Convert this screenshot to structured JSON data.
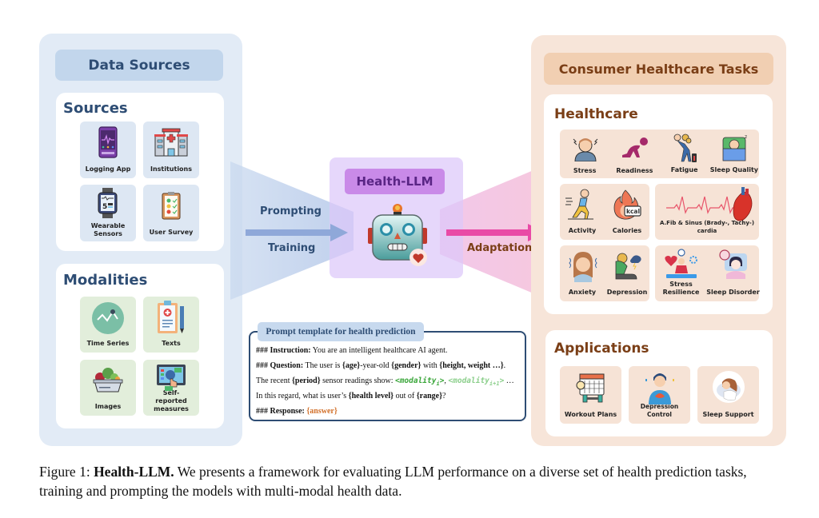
{
  "data_sources": {
    "title": "Data Sources",
    "sources": {
      "title": "Sources",
      "items": [
        {
          "label": "Logging App",
          "icon": "phone-app-icon"
        },
        {
          "label": "Institutions",
          "icon": "hospital-icon"
        },
        {
          "label": "Wearable Sensors",
          "icon": "smartwatch-icon"
        },
        {
          "label": "User Survey",
          "icon": "clipboard-survey-icon"
        }
      ]
    },
    "modalities": {
      "title": "Modalities",
      "items": [
        {
          "label": "Time Series",
          "icon": "line-graph-icon"
        },
        {
          "label": "Texts",
          "icon": "medical-report-icon"
        },
        {
          "label": "Images",
          "icon": "food-bowl-icon"
        },
        {
          "label": "Self-reported measures",
          "icon": "touch-screen-icon"
        }
      ]
    }
  },
  "flow": {
    "prompting": "Prompting",
    "training": "Training",
    "adaptation": "Adaptation"
  },
  "model": {
    "title": "Health-LLM",
    "icon": "robot-icon"
  },
  "prompt_template": {
    "title": "Prompt template for health prediction",
    "instruction_key": "### Instruction:",
    "instruction_text": " You are an intelligent healthcare AI agent.",
    "question_key": "### Question:",
    "q_text1": " The user is ",
    "q_age": "{age}",
    "q_text2": "-year-old ",
    "q_gender": "{gender}",
    "q_text3": " with ",
    "q_hw": "{height, weight …}",
    "q_text4": ".",
    "r_text1": "The recent ",
    "r_period": "{period}",
    "r_text2": " sensor readings show: ",
    "r_mod1": "<modality",
    "r_mod1_sub": "i",
    "r_mod1_end": ">",
    "r_comma": ", ",
    "r_mod2": "<modality",
    "r_mod2_sub": "i+1",
    "r_mod2_end": ">",
    "r_ellipsis": " …",
    "h_text1": "In this regard, what is user’s ",
    "h_level": "{health level}",
    "h_text2": " out of ",
    "h_range": "{range}",
    "h_text3": "?",
    "response_key": "### Response:",
    "response_value": "{answer}"
  },
  "tasks": {
    "title": "Consumer Healthcare Tasks",
    "healthcare": {
      "title": "Healthcare",
      "row1": [
        {
          "label": "Stress",
          "icon": "stressed-person-icon"
        },
        {
          "label": "Readiness",
          "icon": "crawling-person-icon"
        },
        {
          "label": "Fatigue",
          "icon": "tired-person-icon"
        },
        {
          "label": "Sleep Quality",
          "icon": "sleeping-person-icon"
        }
      ],
      "row2_left": [
        {
          "label": "Activity",
          "icon": "running-person-icon"
        },
        {
          "label": "Calories",
          "icon": "flame-kcal-icon"
        }
      ],
      "row2_right": {
        "label": "A.Fib & Sinus (Brady-, Tachy-) cardia",
        "icon": "heart-ecg-icon"
      },
      "row3_left": [
        {
          "label": "Anxiety",
          "icon": "anxious-woman-icon"
        },
        {
          "label": "Depression",
          "icon": "depressed-person-icon"
        }
      ],
      "row3_right": [
        {
          "label": "Stress Resilience",
          "icon": "meditation-icon"
        },
        {
          "label": "Sleep Disorder",
          "icon": "insomnia-icon"
        }
      ]
    },
    "applications": {
      "title": "Applications",
      "items": [
        {
          "label": "Workout Plans",
          "icon": "calendar-dumbbell-icon"
        },
        {
          "label": "Depression Control",
          "icon": "calm-person-icon"
        },
        {
          "label": "Sleep Support",
          "icon": "sleeping-woman-icon"
        }
      ]
    }
  },
  "caption": {
    "prefix": "Figure 1: ",
    "bold": "Health-LLM.",
    "text": " We presents a framework for evaluating LLM performance on a diverse set of health prediction tasks, training and prompting the models with multi-modal health data."
  },
  "colors": {
    "left_panel": "#e2ebf6",
    "left_title": "#c2d6ec",
    "llm_box": "#ddc8fa",
    "llm_title": "#c98ae8",
    "right_panel": "#f7e5d9",
    "right_title": "#f1cfb2",
    "adaptation_arrow": "#e94aa6",
    "prompt_arrow": "#8fa8d9"
  }
}
